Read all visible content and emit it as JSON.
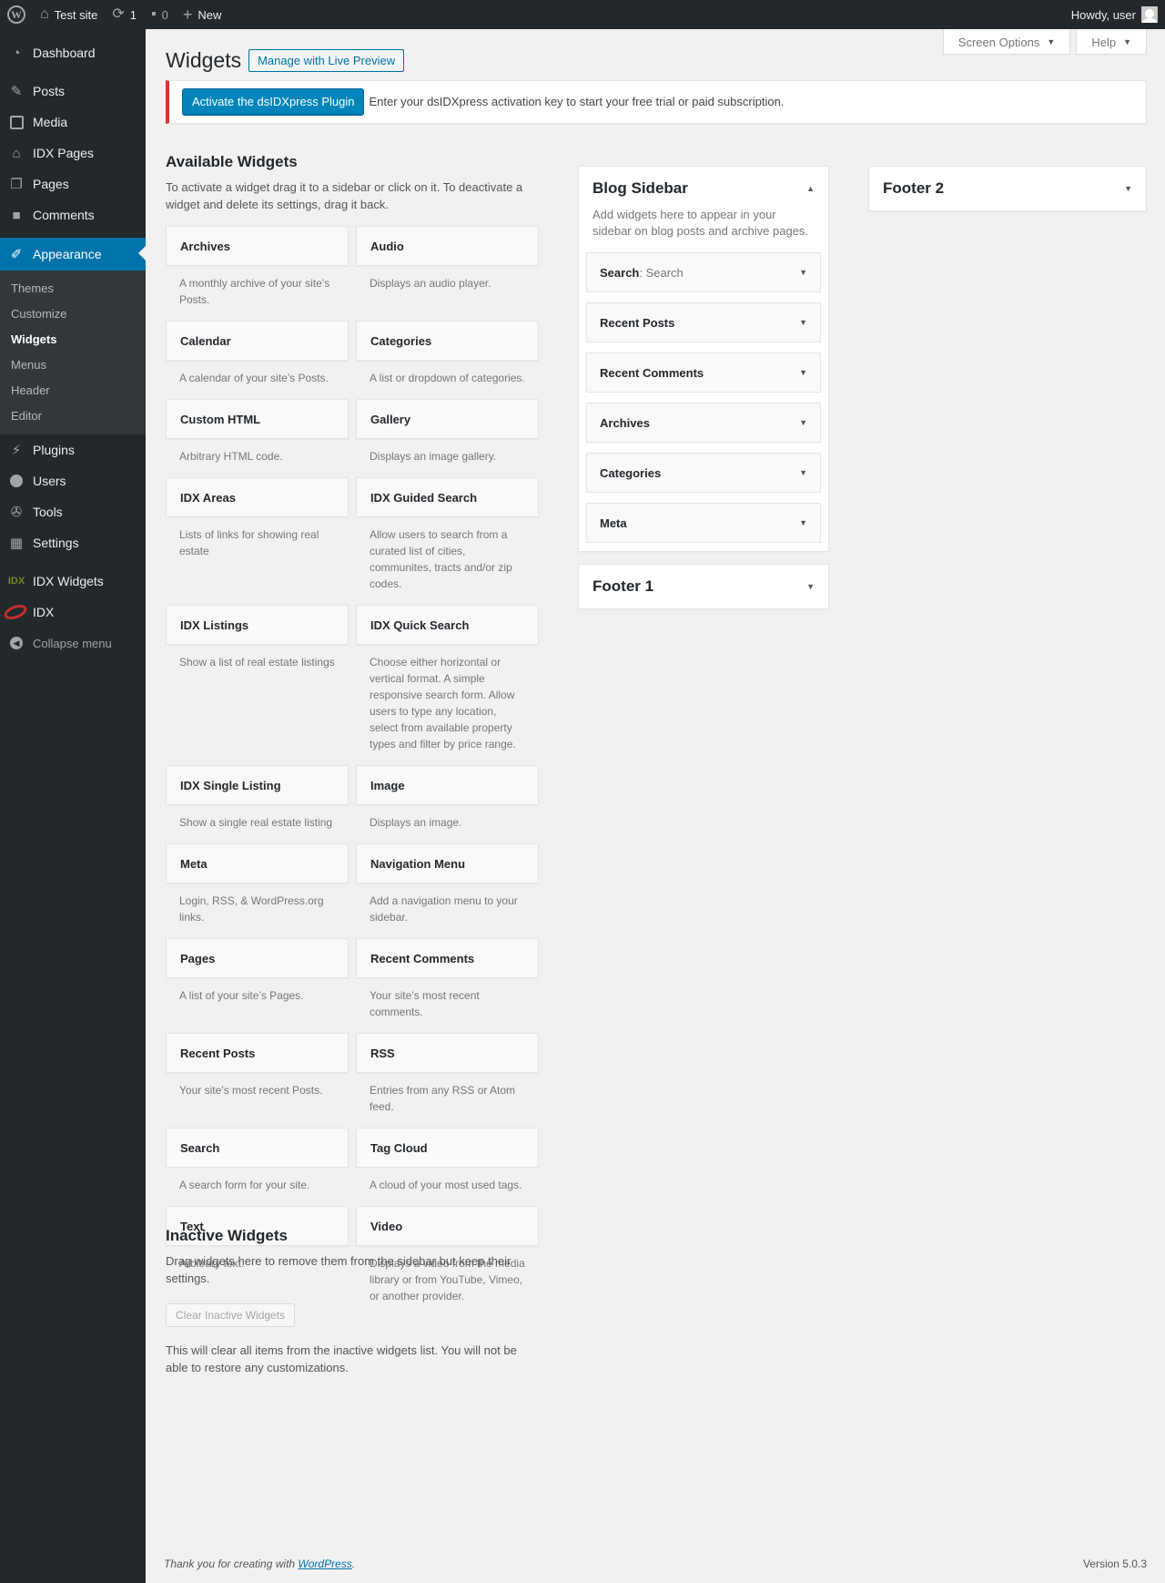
{
  "adminbar": {
    "site_name": "Test site",
    "updates_count": "1",
    "comments_count": "0",
    "new_label": "New",
    "howdy": "Howdy, user"
  },
  "menu": {
    "top": [
      {
        "label": "Dashboard",
        "icon": "dashboard-icon"
      },
      {
        "label": "Posts",
        "icon": "pin-icon"
      },
      {
        "label": "Media",
        "icon": "media-icon"
      },
      {
        "label": "IDX Pages",
        "icon": "home-icon"
      },
      {
        "label": "Pages",
        "icon": "pages-icon"
      },
      {
        "label": "Comments",
        "icon": "comment-icon"
      }
    ],
    "appearance": "Appearance",
    "sub": [
      "Themes",
      "Customize",
      "Widgets",
      "Menus",
      "Header",
      "Editor"
    ],
    "bottom": [
      {
        "label": "Plugins",
        "icon": "plugin-icon"
      },
      {
        "label": "Users",
        "icon": "users-icon"
      },
      {
        "label": "Tools",
        "icon": "wrench-icon"
      },
      {
        "label": "Settings",
        "icon": "settings-icon"
      }
    ],
    "idx_widgets": "IDX Widgets",
    "idx": "IDX",
    "collapse": "Collapse menu"
  },
  "screen_options": "Screen Options",
  "help": "Help",
  "page": {
    "title": "Widgets",
    "live_preview": "Manage with Live Preview"
  },
  "notice": {
    "button": "Activate the dsIDXpress Plugin",
    "text": "Enter your dsIDXpress activation key to start your free trial or paid subscription."
  },
  "available": {
    "title": "Available Widgets",
    "desc": "To activate a widget drag it to a sidebar or click on it. To deactivate a widget and delete its settings, drag it back.",
    "widgets": [
      {
        "title": "Archives",
        "desc": "A monthly archive of your site’s Posts."
      },
      {
        "title": "Audio",
        "desc": "Displays an audio player."
      },
      {
        "title": "Calendar",
        "desc": "A calendar of your site’s Posts."
      },
      {
        "title": "Categories",
        "desc": "A list or dropdown of categories."
      },
      {
        "title": "Custom HTML",
        "desc": "Arbitrary HTML code."
      },
      {
        "title": "Gallery",
        "desc": "Displays an image gallery."
      },
      {
        "title": "IDX Areas",
        "desc": "Lists of links for showing real estate"
      },
      {
        "title": "IDX Guided Search",
        "desc": "Allow users to search from a curated list of cities, communites, tracts and/or zip codes."
      },
      {
        "title": "IDX Listings",
        "desc": "Show a list of real estate listings"
      },
      {
        "title": "IDX Quick Search",
        "desc": "Choose either horizontal or vertical format. A simple responsive search form. Allow users to type any location, select from available property types and filter by price range."
      },
      {
        "title": "IDX Single Listing",
        "desc": "Show a single real estate listing"
      },
      {
        "title": "Image",
        "desc": "Displays an image."
      },
      {
        "title": "Meta",
        "desc": "Login, RSS, & WordPress.org links."
      },
      {
        "title": "Navigation Menu",
        "desc": "Add a navigation menu to your sidebar."
      },
      {
        "title": "Pages",
        "desc": "A list of your site’s Pages."
      },
      {
        "title": "Recent Comments",
        "desc": "Your site’s most recent comments."
      },
      {
        "title": "Recent Posts",
        "desc": "Your site’s most recent Posts."
      },
      {
        "title": "RSS",
        "desc": "Entries from any RSS or Atom feed."
      },
      {
        "title": "Search",
        "desc": "A search form for your site."
      },
      {
        "title": "Tag Cloud",
        "desc": "A cloud of your most used tags."
      },
      {
        "title": "Text",
        "desc": "Arbitrary text."
      },
      {
        "title": "Video",
        "desc": "Displays a video from the media library or from YouTube, Vimeo, or another provider."
      }
    ]
  },
  "inactive": {
    "title": "Inactive Widgets",
    "desc": "Drag widgets here to remove them from the sidebar but keep their settings.",
    "clear_button": "Clear Inactive Widgets",
    "note": "This will clear all items from the inactive widgets list. You will not be able to restore any customizations."
  },
  "blog_sidebar": {
    "name": "Blog Sidebar",
    "desc": "Add widgets here to appear in your sidebar on blog posts and archive pages.",
    "widgets": [
      {
        "title": "Search",
        "in_title": ": Search"
      },
      {
        "title": "Recent Posts",
        "in_title": ""
      },
      {
        "title": "Recent Comments",
        "in_title": ""
      },
      {
        "title": "Archives",
        "in_title": ""
      },
      {
        "title": "Categories",
        "in_title": ""
      },
      {
        "title": "Meta",
        "in_title": ""
      }
    ]
  },
  "footer1": {
    "name": "Footer 1"
  },
  "footer2": {
    "name": "Footer 2"
  },
  "footer": {
    "thanks_prefix": "Thank you for creating with ",
    "wp_link": "WordPress",
    "thanks_suffix": ".",
    "version": "Version 5.0.3"
  }
}
